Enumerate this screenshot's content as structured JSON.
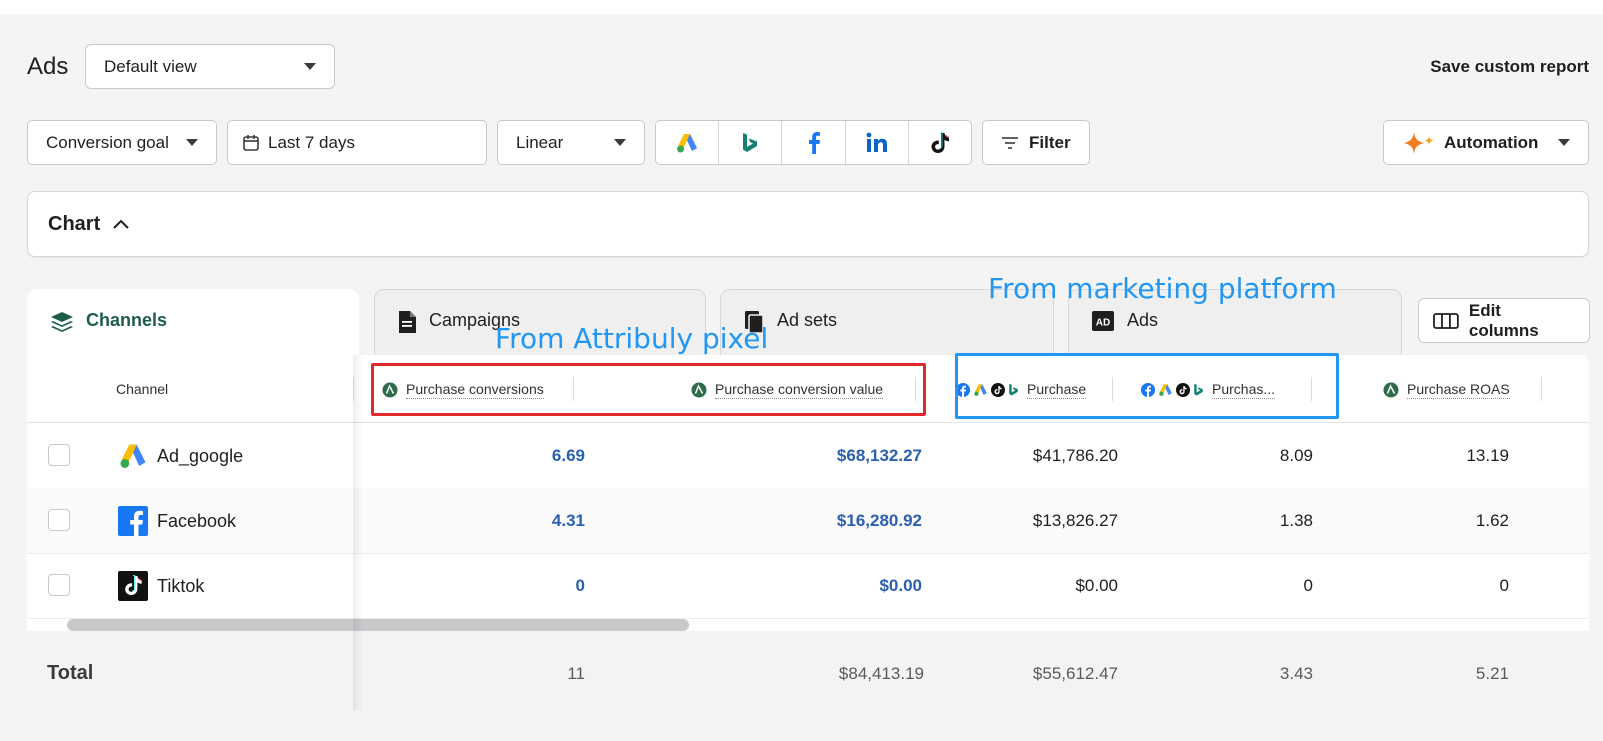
{
  "header": {
    "title": "Ads",
    "view_select": "Default view",
    "save_report": "Save custom report"
  },
  "filters": {
    "conversion_goal": "Conversion goal",
    "date_range": "Last 7 days",
    "model": "Linear",
    "platforms": [
      "google-ads-icon",
      "bing-icon",
      "facebook-icon",
      "linkedin-icon",
      "tiktok-icon"
    ],
    "filter_label": "Filter",
    "automation_label": "Automation"
  },
  "chart_panel": {
    "label": "Chart"
  },
  "tabs": [
    {
      "label": "Channels",
      "active": true
    },
    {
      "label": "Campaigns",
      "active": false
    },
    {
      "label": "Ad sets",
      "active": false
    },
    {
      "label": "Ads",
      "active": false
    }
  ],
  "edit_columns": "Edit columns",
  "table": {
    "columns": [
      "Channel",
      "Purchase conversions",
      "Purchase conversion value",
      "Purchase",
      "Purchas...",
      "Purchase ROAS"
    ],
    "rows": [
      {
        "channel": "Ad_google",
        "icon": "google-ads-icon",
        "values": [
          "6.69",
          "$68,132.27",
          "$41,786.20",
          "8.09",
          "13.19"
        ]
      },
      {
        "channel": "Facebook",
        "icon": "facebook-icon",
        "values": [
          "4.31",
          "$16,280.92",
          "$13,826.27",
          "1.38",
          "1.62"
        ]
      },
      {
        "channel": "Tiktok",
        "icon": "tiktok-icon",
        "values": [
          "0",
          "$0.00",
          "$0.00",
          "0",
          "0"
        ]
      }
    ],
    "total": {
      "label": "Total",
      "values": [
        "11",
        "$84,413.19",
        "$55,612.47",
        "3.43",
        "5.21"
      ]
    }
  },
  "annotations": {
    "pixel": "From Attribuly pixel",
    "platform": "From marketing platform"
  },
  "colors": {
    "accent_green": "#1e5e45",
    "value_blue": "#2b5fb0",
    "annotation_blue": "#2196f3",
    "annotation_red": "#e0292b"
  }
}
